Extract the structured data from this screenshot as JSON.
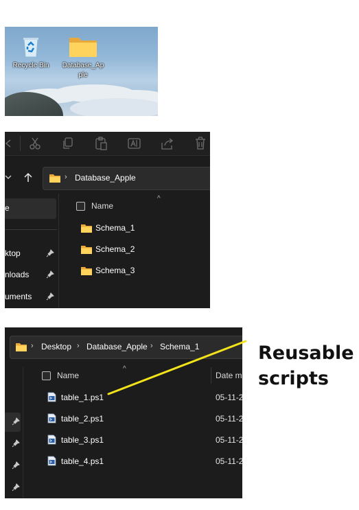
{
  "desktop": {
    "icons": [
      {
        "icon": "recycle-bin-icon",
        "label": "Recycle Bin"
      },
      {
        "icon": "folder-icon",
        "label": "Database_Ap ple"
      }
    ]
  },
  "explorer1": {
    "toolbar_icons": [
      "cut-icon",
      "copy-icon",
      "paste-icon",
      "rename-icon",
      "share-icon",
      "delete-icon"
    ],
    "address_path": [
      "Database_Apple"
    ],
    "nav": {
      "selected_fragment": "e",
      "items": [
        "ktop",
        "nloads",
        "uments"
      ]
    },
    "column_header": "Name",
    "folders": [
      "Schema_1",
      "Schema_2",
      "Schema_3"
    ]
  },
  "explorer2": {
    "address_path": [
      "Desktop",
      "Database_Apple",
      "Schema_1"
    ],
    "column_headers": {
      "name": "Name",
      "date": "Date m"
    },
    "files": [
      {
        "name": "table_1.ps1",
        "date": "05-11-2"
      },
      {
        "name": "table_2.ps1",
        "date": "05-11-2"
      },
      {
        "name": "table_3.ps1",
        "date": "05-11-2"
      },
      {
        "name": "table_4.ps1",
        "date": "05-11-2"
      }
    ]
  },
  "annotation": {
    "text_line1": "Reusable",
    "text_line2": "scripts",
    "color": "#f2e31b"
  }
}
